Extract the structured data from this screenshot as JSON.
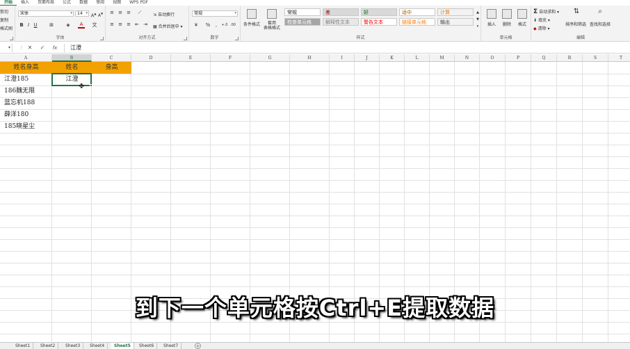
{
  "ribbon_tabs": [
    "开始",
    "插入",
    "页面布局",
    "公式",
    "数据",
    "审阅",
    "视图",
    "WPS PDF"
  ],
  "active_tab": "开始",
  "clipboard": {
    "cut": "剪切",
    "copy": "复制",
    "painter": "格式刷"
  },
  "font": {
    "name": "宋体",
    "size": "14",
    "group_label": "字体",
    "bold": "B",
    "italic": "I",
    "underline": "U",
    "color_letter": "A"
  },
  "alignment": {
    "wrap": "自动换行",
    "merge": "合并后居中",
    "group_label": "对齐方式"
  },
  "number": {
    "format": "常规",
    "percent": "%",
    "group_label": "数字"
  },
  "styles": {
    "conditional": "条件格式",
    "table_format": "套用\n表格格式",
    "cells": [
      {
        "label": "常规",
        "bg": "#ffffff",
        "color": "#222222"
      },
      {
        "label": "差",
        "bg": "#d9d9d9",
        "color": "#9c0006"
      },
      {
        "label": "好",
        "bg": "#d9d9d9",
        "color": "#006100"
      },
      {
        "label": "适中",
        "bg": "#ffffff",
        "color": "#9c5700"
      },
      {
        "label": "计算",
        "bg": "#f2f2f2",
        "color": "#fa7d00"
      },
      {
        "label": "检查单元格",
        "bg": "#a5a5a5",
        "color": "#ffffff"
      },
      {
        "label": "解释性文本",
        "bg": "#e8e8e8",
        "color": "#7f7f7f"
      },
      {
        "label": "警告文本",
        "bg": "#ffffff",
        "color": "#ff0000"
      },
      {
        "label": "链接单元格",
        "bg": "#ffffff",
        "color": "#fa7d00"
      },
      {
        "label": "输出",
        "bg": "#f2f2f2",
        "color": "#3f3f3f"
      }
    ],
    "group_label": "样式"
  },
  "cells_group": {
    "insert": "插入",
    "delete": "删除",
    "format": "格式",
    "group_label": "单元格"
  },
  "editing": {
    "autosum": "自动求和",
    "fill": "填充",
    "clear": "清除",
    "sort": "排序和筛选",
    "find": "查找和选择",
    "group_label": "编辑"
  },
  "formula_bar": {
    "name_box": "",
    "cancel": "✕",
    "confirm": "✓",
    "fx": "fx",
    "content": "江澄"
  },
  "columns": [
    "A",
    "B",
    "C",
    "D",
    "E",
    "F",
    "G",
    "H",
    "I",
    "J",
    "K",
    "L",
    "M",
    "N",
    "O",
    "P",
    "Q",
    "R",
    "S",
    "T"
  ],
  "selected_column": "B",
  "sheet": {
    "headers": [
      "姓名身高",
      "姓名",
      "身高"
    ],
    "rows": [
      [
        "江澄185",
        "江澄",
        ""
      ],
      [
        "186魏无限",
        "",
        ""
      ],
      [
        "蓝忘机188",
        "",
        ""
      ],
      [
        "薛洋180",
        "",
        ""
      ],
      [
        "185晓星尘",
        "",
        ""
      ]
    ],
    "header_color": "#f2a200"
  },
  "subtitle": "到下一个单元格按Ctrl+E提取数据",
  "sheet_tabs": [
    "Sheet1",
    "Sheet2",
    "Sheet3",
    "Sheet4",
    "Sheet5",
    "Sheet6",
    "Sheet7"
  ],
  "active_sheet": "Sheet5",
  "add_sheet": "+"
}
